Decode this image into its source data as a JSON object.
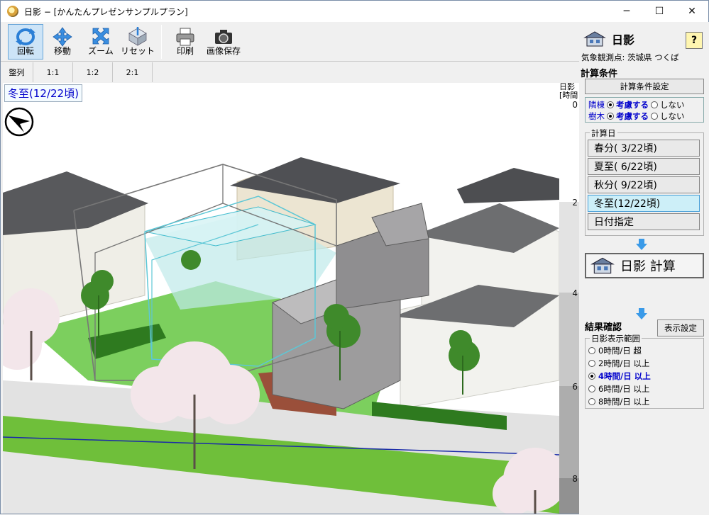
{
  "window": {
    "title": "日影 − [かんたんプレゼンサンプルプラン]",
    "controls": [
      "─",
      "☐",
      "✕"
    ]
  },
  "toolbar": {
    "buttons": [
      {
        "label": "回転",
        "icon": "rotate-icon",
        "active": true
      },
      {
        "label": "移動",
        "icon": "move-icon",
        "active": false
      },
      {
        "label": "ズーム",
        "icon": "zoom-icon",
        "active": false
      },
      {
        "label": "リセット",
        "icon": "reset-icon",
        "active": false
      },
      {
        "label": "印刷",
        "icon": "printer-icon",
        "active": false
      },
      {
        "label": "画像保存",
        "icon": "camera-icon",
        "active": false
      }
    ]
  },
  "viewbar": {
    "buttons": [
      "整列",
      "1:1",
      "1:2",
      "2:1"
    ]
  },
  "viewport": {
    "season_label": "冬至(12/22頃)",
    "compass_icon": "north-arrow-icon"
  },
  "scale": {
    "header": "日影\n[時間",
    "ticks": [
      "0",
      "2",
      "4",
      "6",
      "8"
    ],
    "colors": [
      "#ffffff",
      "#e3e3e3",
      "#c8c8c8",
      "#adadad",
      "#919191"
    ]
  },
  "panel": {
    "title": "日影",
    "help": "?",
    "station": "気象観測点: 茨城県 つくば",
    "calc_conditions_heading": "計算条件",
    "calc_conditions_button": "計算条件設定",
    "neighbors": {
      "label": "隣棟",
      "consider": "考慮する",
      "not": "しない",
      "selected": "consider"
    },
    "trees": {
      "label": "樹木",
      "consider": "考慮する",
      "not": "しない",
      "selected": "consider"
    },
    "calc_date_legend": "計算日",
    "dates": [
      {
        "label": "春分( 3/22頃)",
        "selected": false
      },
      {
        "label": "夏至( 6/22頃)",
        "selected": false
      },
      {
        "label": "秋分( 9/22頃)",
        "selected": false
      },
      {
        "label": "冬至(12/22頃)",
        "selected": true
      },
      {
        "label": "日付指定",
        "selected": false
      }
    ],
    "calc_button": "日影 計算",
    "result_heading": "結果確認",
    "display_settings_button": "表示設定",
    "range_legend": "日影表示範囲",
    "ranges": [
      {
        "label": "0時間/日 超",
        "selected": false
      },
      {
        "label": "2時間/日 以上",
        "selected": false
      },
      {
        "label": "4時間/日 以上",
        "selected": true
      },
      {
        "label": "6時間/日 以上",
        "selected": false
      },
      {
        "label": "8時間/日 以上",
        "selected": false
      }
    ]
  }
}
